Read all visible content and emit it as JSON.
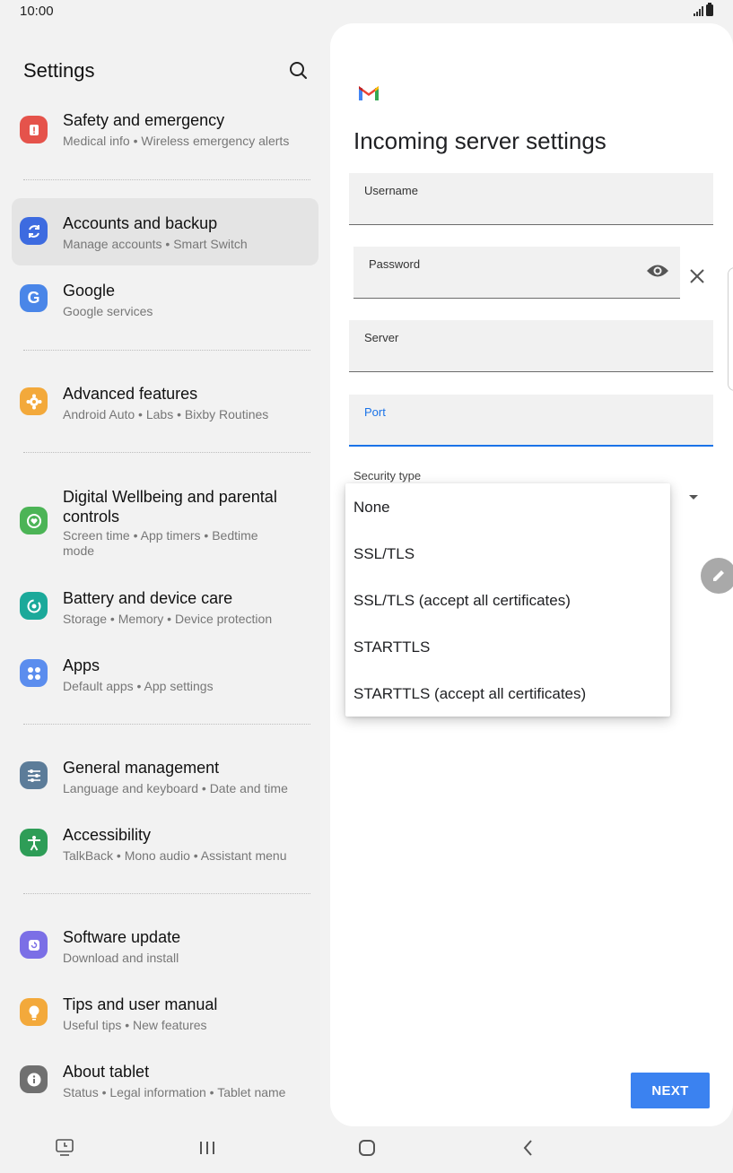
{
  "status": {
    "time": "10:00"
  },
  "settings": {
    "title": "Settings",
    "items": [
      {
        "title": "Safety and emergency",
        "subtitle": "Medical info  •  Wireless emergency alerts",
        "icon": "alert-icon",
        "color": "#e5534b"
      },
      {
        "title": "Accounts and backup",
        "subtitle": "Manage accounts  •  Smart Switch",
        "icon": "sync-icon",
        "color": "#3d6be0"
      },
      {
        "title": "Google",
        "subtitle": "Google services",
        "icon": "google-icon",
        "color": "#4a86e8"
      },
      {
        "title": "Advanced features",
        "subtitle": "Android Auto  •  Labs  •  Bixby Routines",
        "icon": "star-gear-icon",
        "color": "#f3a93b"
      },
      {
        "title": "Digital Wellbeing and parental",
        "title2": "controls",
        "subtitle": "Screen time  •  App timers  •  Bedtime",
        "subtitle2": "mode",
        "icon": "wellbeing-icon",
        "color": "#4cb456"
      },
      {
        "title": "Battery and device care",
        "subtitle": "Storage  •  Memory  •  Device protection",
        "icon": "device-care-icon",
        "color": "#1ba99a"
      },
      {
        "title": "Apps",
        "subtitle": "Default apps  •  App settings",
        "icon": "apps-icon",
        "color": "#5b8dee"
      },
      {
        "title": "General management",
        "subtitle": "Language and keyboard  •  Date and time",
        "icon": "sliders-icon",
        "color": "#5c7c99"
      },
      {
        "title": "Accessibility",
        "subtitle": "TalkBack  •  Mono audio  •  Assistant menu",
        "icon": "accessibility-icon",
        "color": "#2e9d57"
      },
      {
        "title": "Software update",
        "subtitle": "Download and install",
        "icon": "update-icon",
        "color": "#7b6fe6"
      },
      {
        "title": "Tips and user manual",
        "subtitle": "Useful tips  •  New features",
        "icon": "bulb-icon",
        "color": "#f3a93b"
      },
      {
        "title": "About tablet",
        "subtitle": "Status  •  Legal information  •  Tablet name",
        "icon": "info-icon",
        "color": "#707070"
      }
    ]
  },
  "server": {
    "title": "Incoming server settings",
    "username_label": "Username",
    "password_label": "Password",
    "server_label": "Server",
    "port_label": "Port",
    "security_label": "Security type",
    "next_label": "NEXT",
    "accent": "#1a73e8"
  },
  "security_menu": {
    "options": [
      "None",
      "SSL/TLS",
      "SSL/TLS (accept all certificates)",
      "STARTTLS",
      "STARTTLS (accept all certificates)"
    ]
  }
}
